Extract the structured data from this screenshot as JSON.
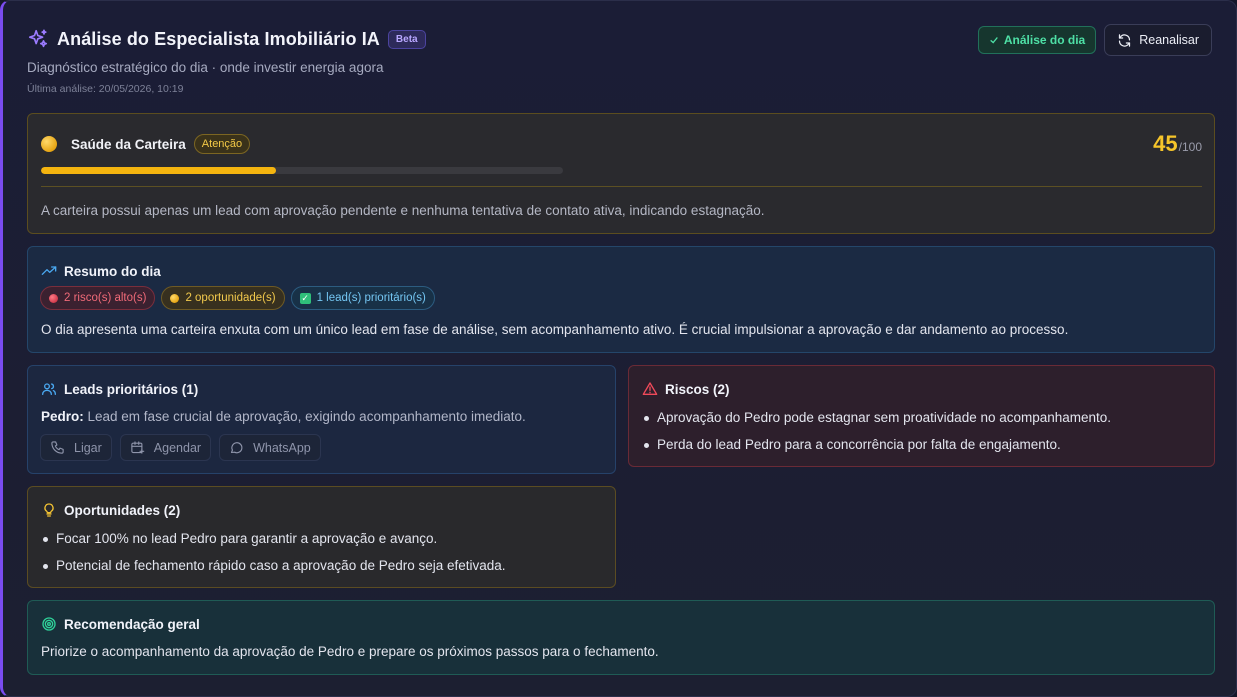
{
  "header": {
    "title": "Análise do Especialista Imobiliário IA",
    "badge": "Beta",
    "subtitle": "Diagnóstico estratégico do dia · onde investir energia agora",
    "last_analysis": "Última análise: 20/05/2026, 10:19",
    "day_button": "Análise do dia",
    "reanalyze_button": "Reanalisar"
  },
  "health": {
    "title": "Saúde da Carteira",
    "status": "Atenção",
    "score": "45",
    "score_max": "/100",
    "score_fraction": 0.45,
    "description": "A carteira possui apenas um lead com aprovação pendente e nenhuma tentativa de contato ativa, indicando estagnação.",
    "colors": {
      "accent": "#f4b40f",
      "status": "#f3c947"
    }
  },
  "summary": {
    "title": "Resumo do dia",
    "pills": {
      "risks": "2 risco(s) alto(s)",
      "opportunities": "2 oportunidade(s)",
      "priority": "1 lead(s) prioritário(s)"
    },
    "text": "O dia apresenta uma carteira enxuta com um único lead em fase de análise, sem acompanhamento ativo. É crucial impulsionar a aprovação e dar andamento ao processo."
  },
  "leads": {
    "title": "Leads prioritários (1)",
    "lead_name": "Pedro:",
    "lead_text": " Lead em fase crucial de aprovação, exigindo acompanhamento imediato.",
    "actions": {
      "call": "Ligar",
      "schedule": "Agendar",
      "whatsapp": "WhatsApp"
    }
  },
  "risks": {
    "title": "Riscos (2)",
    "items": [
      "Aprovação do Pedro pode estagnar sem proatividade no acompanhamento.",
      "Perda do lead Pedro para a concorrência por falta de engajamento."
    ]
  },
  "opportunities": {
    "title": "Oportunidades (2)",
    "items": [
      "Focar 100% no lead Pedro para garantir a aprovação e avanço.",
      "Potencial de fechamento rápido caso a aprovação de Pedro seja efetivada."
    ]
  },
  "recommendation": {
    "title": "Recomendação geral",
    "text": "Priorize o acompanhamento da aprovação de Pedro e prepare os próximos passos para o fechamento."
  }
}
